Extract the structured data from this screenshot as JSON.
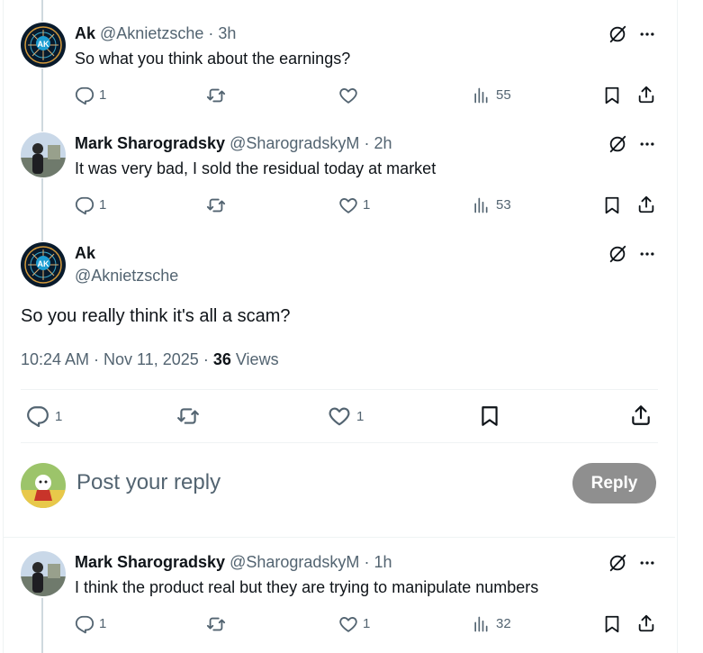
{
  "posts": [
    {
      "name": "Ak",
      "handle": "@Aknietzsche",
      "time": "3h",
      "text": "So what you think about the earnings?",
      "replies": "1",
      "likes": "",
      "views": "55"
    },
    {
      "name": "Mark Sharogradsky",
      "handle": "@SharogradskyM",
      "time": "2h",
      "text": "It was very bad, I sold the residual today at market",
      "replies": "1",
      "likes": "1",
      "views": "53"
    }
  ],
  "main_post": {
    "name": "Ak",
    "handle": "@Aknietzsche",
    "text": "So you really think it's all a scam?",
    "timestamp": "10:24 AM · Nov 11, 2025",
    "views_count": "36",
    "views_label": "Views",
    "replies": "1",
    "likes": "1"
  },
  "composer": {
    "placeholder": "Post your reply",
    "button": "Reply"
  },
  "reply_post": {
    "name": "Mark Sharogradsky",
    "handle": "@SharogradskyM",
    "time": "1h",
    "text": "I think the product real but they are trying to manipulate numbers",
    "replies": "1",
    "likes": "1",
    "views": "32"
  },
  "colors": {
    "text": "#0f1419",
    "muted": "#536471",
    "reply_button": "#8f8f8f"
  }
}
